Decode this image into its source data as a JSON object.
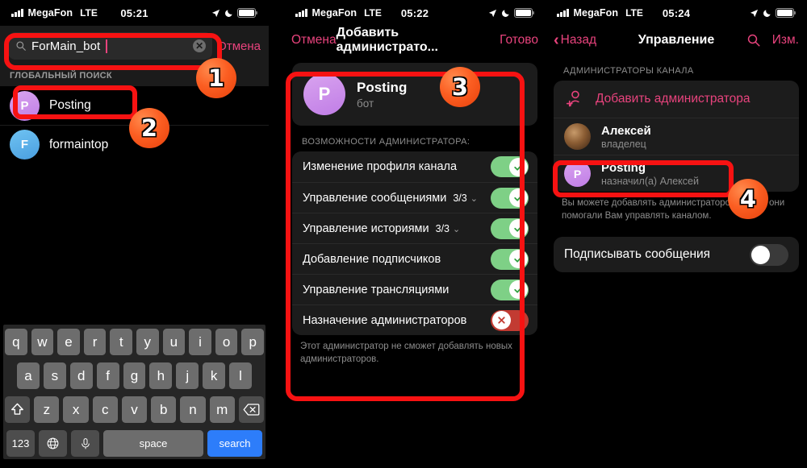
{
  "panel1": {
    "status": {
      "carrier": "MegaFon",
      "network": "LTE",
      "time": "05:21"
    },
    "search": {
      "value": "ForMain_bot",
      "cancel_label": "Отмена",
      "clear_icon": "clear-circle-icon",
      "search_icon": "search-icon"
    },
    "section_header": "ГЛОБАЛЬНЫЙ ПОИСК",
    "results": [
      {
        "initial": "P",
        "name": "Posting",
        "avatar_color": "#c98ae8"
      },
      {
        "initial": "F",
        "name": "formaintop",
        "avatar_color": "#5aaee6"
      }
    ],
    "keyboard": {
      "row1": [
        "q",
        "w",
        "e",
        "r",
        "t",
        "y",
        "u",
        "i",
        "o",
        "p"
      ],
      "row2": [
        "a",
        "s",
        "d",
        "f",
        "g",
        "h",
        "j",
        "k",
        "l"
      ],
      "row3": [
        "z",
        "x",
        "c",
        "v",
        "b",
        "n",
        "m"
      ],
      "shift_icon": "shift-icon",
      "backspace_icon": "backspace-icon",
      "numbers_label": "123",
      "globe_icon": "globe-icon",
      "mic_icon": "microphone-icon",
      "space_label": "space",
      "search_label": "search"
    }
  },
  "panel2": {
    "status": {
      "carrier": "MegaFon",
      "network": "LTE",
      "time": "05:22"
    },
    "nav": {
      "cancel": "Отмена",
      "title": "Добавить администрато...",
      "done": "Готово"
    },
    "bot": {
      "initial": "P",
      "name": "Posting",
      "subtitle": "бот"
    },
    "permissions_header": "ВОЗМОЖНОСТИ АДМИНИСТРАТОРА:",
    "permissions": [
      {
        "label": "Изменение профиля канала",
        "count": "",
        "expandable": false,
        "state": "on"
      },
      {
        "label": "Управление сообщениями",
        "count": "3/3",
        "expandable": true,
        "state": "on"
      },
      {
        "label": "Управление историями",
        "count": "3/3",
        "expandable": true,
        "state": "on"
      },
      {
        "label": "Добавление подписчиков",
        "count": "",
        "expandable": false,
        "state": "on"
      },
      {
        "label": "Управление трансляциями",
        "count": "",
        "expandable": false,
        "state": "on"
      },
      {
        "label": "Назначение администраторов",
        "count": "",
        "expandable": false,
        "state": "off"
      }
    ],
    "footer": "Этот администратор не сможет добавлять новых администраторов."
  },
  "panel3": {
    "status": {
      "carrier": "MegaFon",
      "network": "LTE",
      "time": "05:24"
    },
    "nav": {
      "back": "Назад",
      "title": "Управление",
      "search_icon": "search-icon",
      "edit": "Изм."
    },
    "group_header": "АДМИНИСТРАТОРЫ КАНАЛА",
    "add_admin": {
      "label": "Добавить администратора",
      "icon": "add-person-icon"
    },
    "admins": [
      {
        "initial": "",
        "name": "Алексей",
        "subtitle": "владелец",
        "avatar": "photo"
      },
      {
        "initial": "P",
        "name": "Posting",
        "subtitle": "назначил(а) Алексей",
        "avatar": "purple"
      }
    ],
    "footer": "Вы можете добавлять администраторов, чтобы они помогали Вам управлять каналом.",
    "sign_messages": {
      "label": "Подписывать сообщения",
      "state": "off"
    }
  },
  "annotations": {
    "badges": [
      {
        "number": "1"
      },
      {
        "number": "2"
      },
      {
        "number": "3"
      },
      {
        "number": "4"
      }
    ],
    "highlight_color": "#f71212"
  }
}
